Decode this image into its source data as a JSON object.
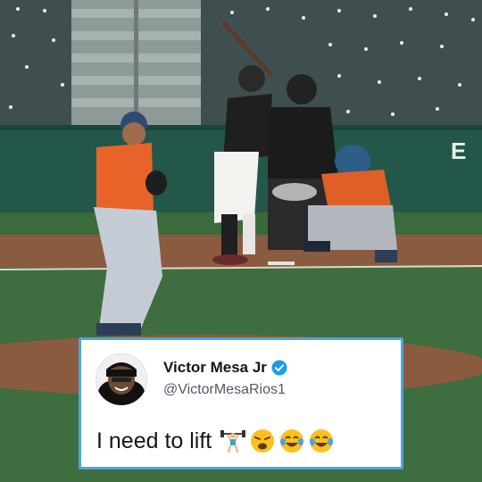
{
  "scene": {
    "description_icon": "baseball-pitch-photo",
    "colors": {
      "grass": "#3d6b3f",
      "dirt": "#8a5a3c",
      "wall": "#1f5a4a",
      "orange_jersey": "#e8632a"
    },
    "wall_sign": "E"
  },
  "tweet": {
    "display_name": "Victor Mesa Jr",
    "handle": "@VictorMesaRios1",
    "text": "I need to lift",
    "verified_color": "#1d9bf0",
    "border_color": "#4fa3e0",
    "emojis": [
      "weightlifter-emoji",
      "weary-face-emoji",
      "tears-of-joy-emoji",
      "tears-of-joy-emoji"
    ]
  }
}
